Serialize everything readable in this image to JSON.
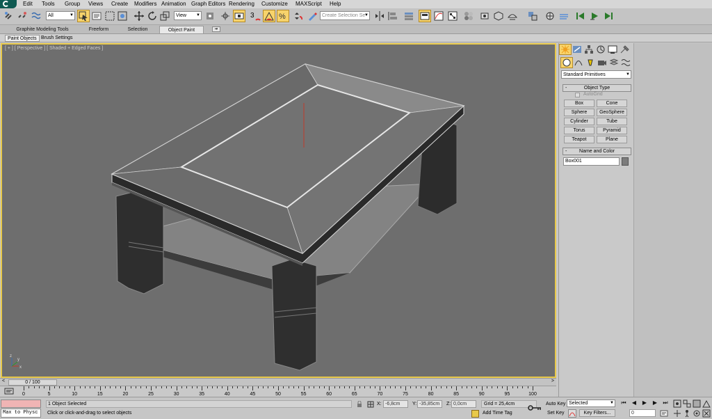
{
  "menu": [
    "Edit",
    "Tools",
    "Group",
    "Views",
    "Create",
    "Modifiers",
    "Animation",
    "Graph Editors",
    "Rendering",
    "Customize",
    "MAXScript",
    "Help"
  ],
  "toolbar": {
    "selection_filter": "All",
    "ref_coord": "View",
    "named_selection_placeholder": "Create Selection Se",
    "snap_label": "3"
  },
  "ribbon": {
    "tabs": [
      "Graphite Modeling Tools",
      "Freeform",
      "Selection",
      "Object Paint"
    ],
    "active_tab": "Object Paint",
    "subtabs": [
      "Paint Objects",
      "Brush Settings"
    ]
  },
  "viewport": {
    "label": "[ + ] [ Perspective ] [ Shaded + Edged Faces ]",
    "axis_labels": [
      "x",
      "y",
      "z"
    ]
  },
  "command_panel": {
    "category": "Standard Primitives",
    "object_type_title": "Object Type",
    "autogrid": "AutoGrid",
    "buttons": [
      "Box",
      "Cone",
      "Sphere",
      "GeoSphere",
      "Cylinder",
      "Tube",
      "Torus",
      "Pyramid",
      "Teapot",
      "Plane"
    ],
    "name_color_title": "Name and Color",
    "object_name": "Box001",
    "object_color": "#7c7c7c"
  },
  "timeline": {
    "frame_counter": "0 / 100",
    "ticks": [
      "0",
      "5",
      "10",
      "15",
      "20",
      "25",
      "30",
      "35",
      "40",
      "45",
      "50",
      "55",
      "60",
      "65",
      "70",
      "75",
      "80",
      "85",
      "90",
      "95",
      "100"
    ],
    "left_arrow": "<",
    "right_arrow": ">"
  },
  "status": {
    "script_listener": "Max to Physc",
    "selection": "1 Object Selected",
    "prompt": "Click or click-and-drag to select objects",
    "x_label": "X:",
    "x_value": "-6,8cm",
    "y_label": "Y:",
    "y_value": "-35,85cm",
    "z_label": "Z:",
    "z_value": "0,0cm",
    "grid": "Grid = 25,4cm",
    "add_time_tag": "Add Time Tag",
    "auto_key": "Auto Key",
    "set_key": "Set Key",
    "key_mode": "Selected",
    "key_filters": "Key Filters...",
    "current_frame": "0"
  },
  "colors": {
    "viewport_bg": "#6e6e6e",
    "viewport_border": "#e8c94a",
    "active_button": "#f7d36b"
  }
}
